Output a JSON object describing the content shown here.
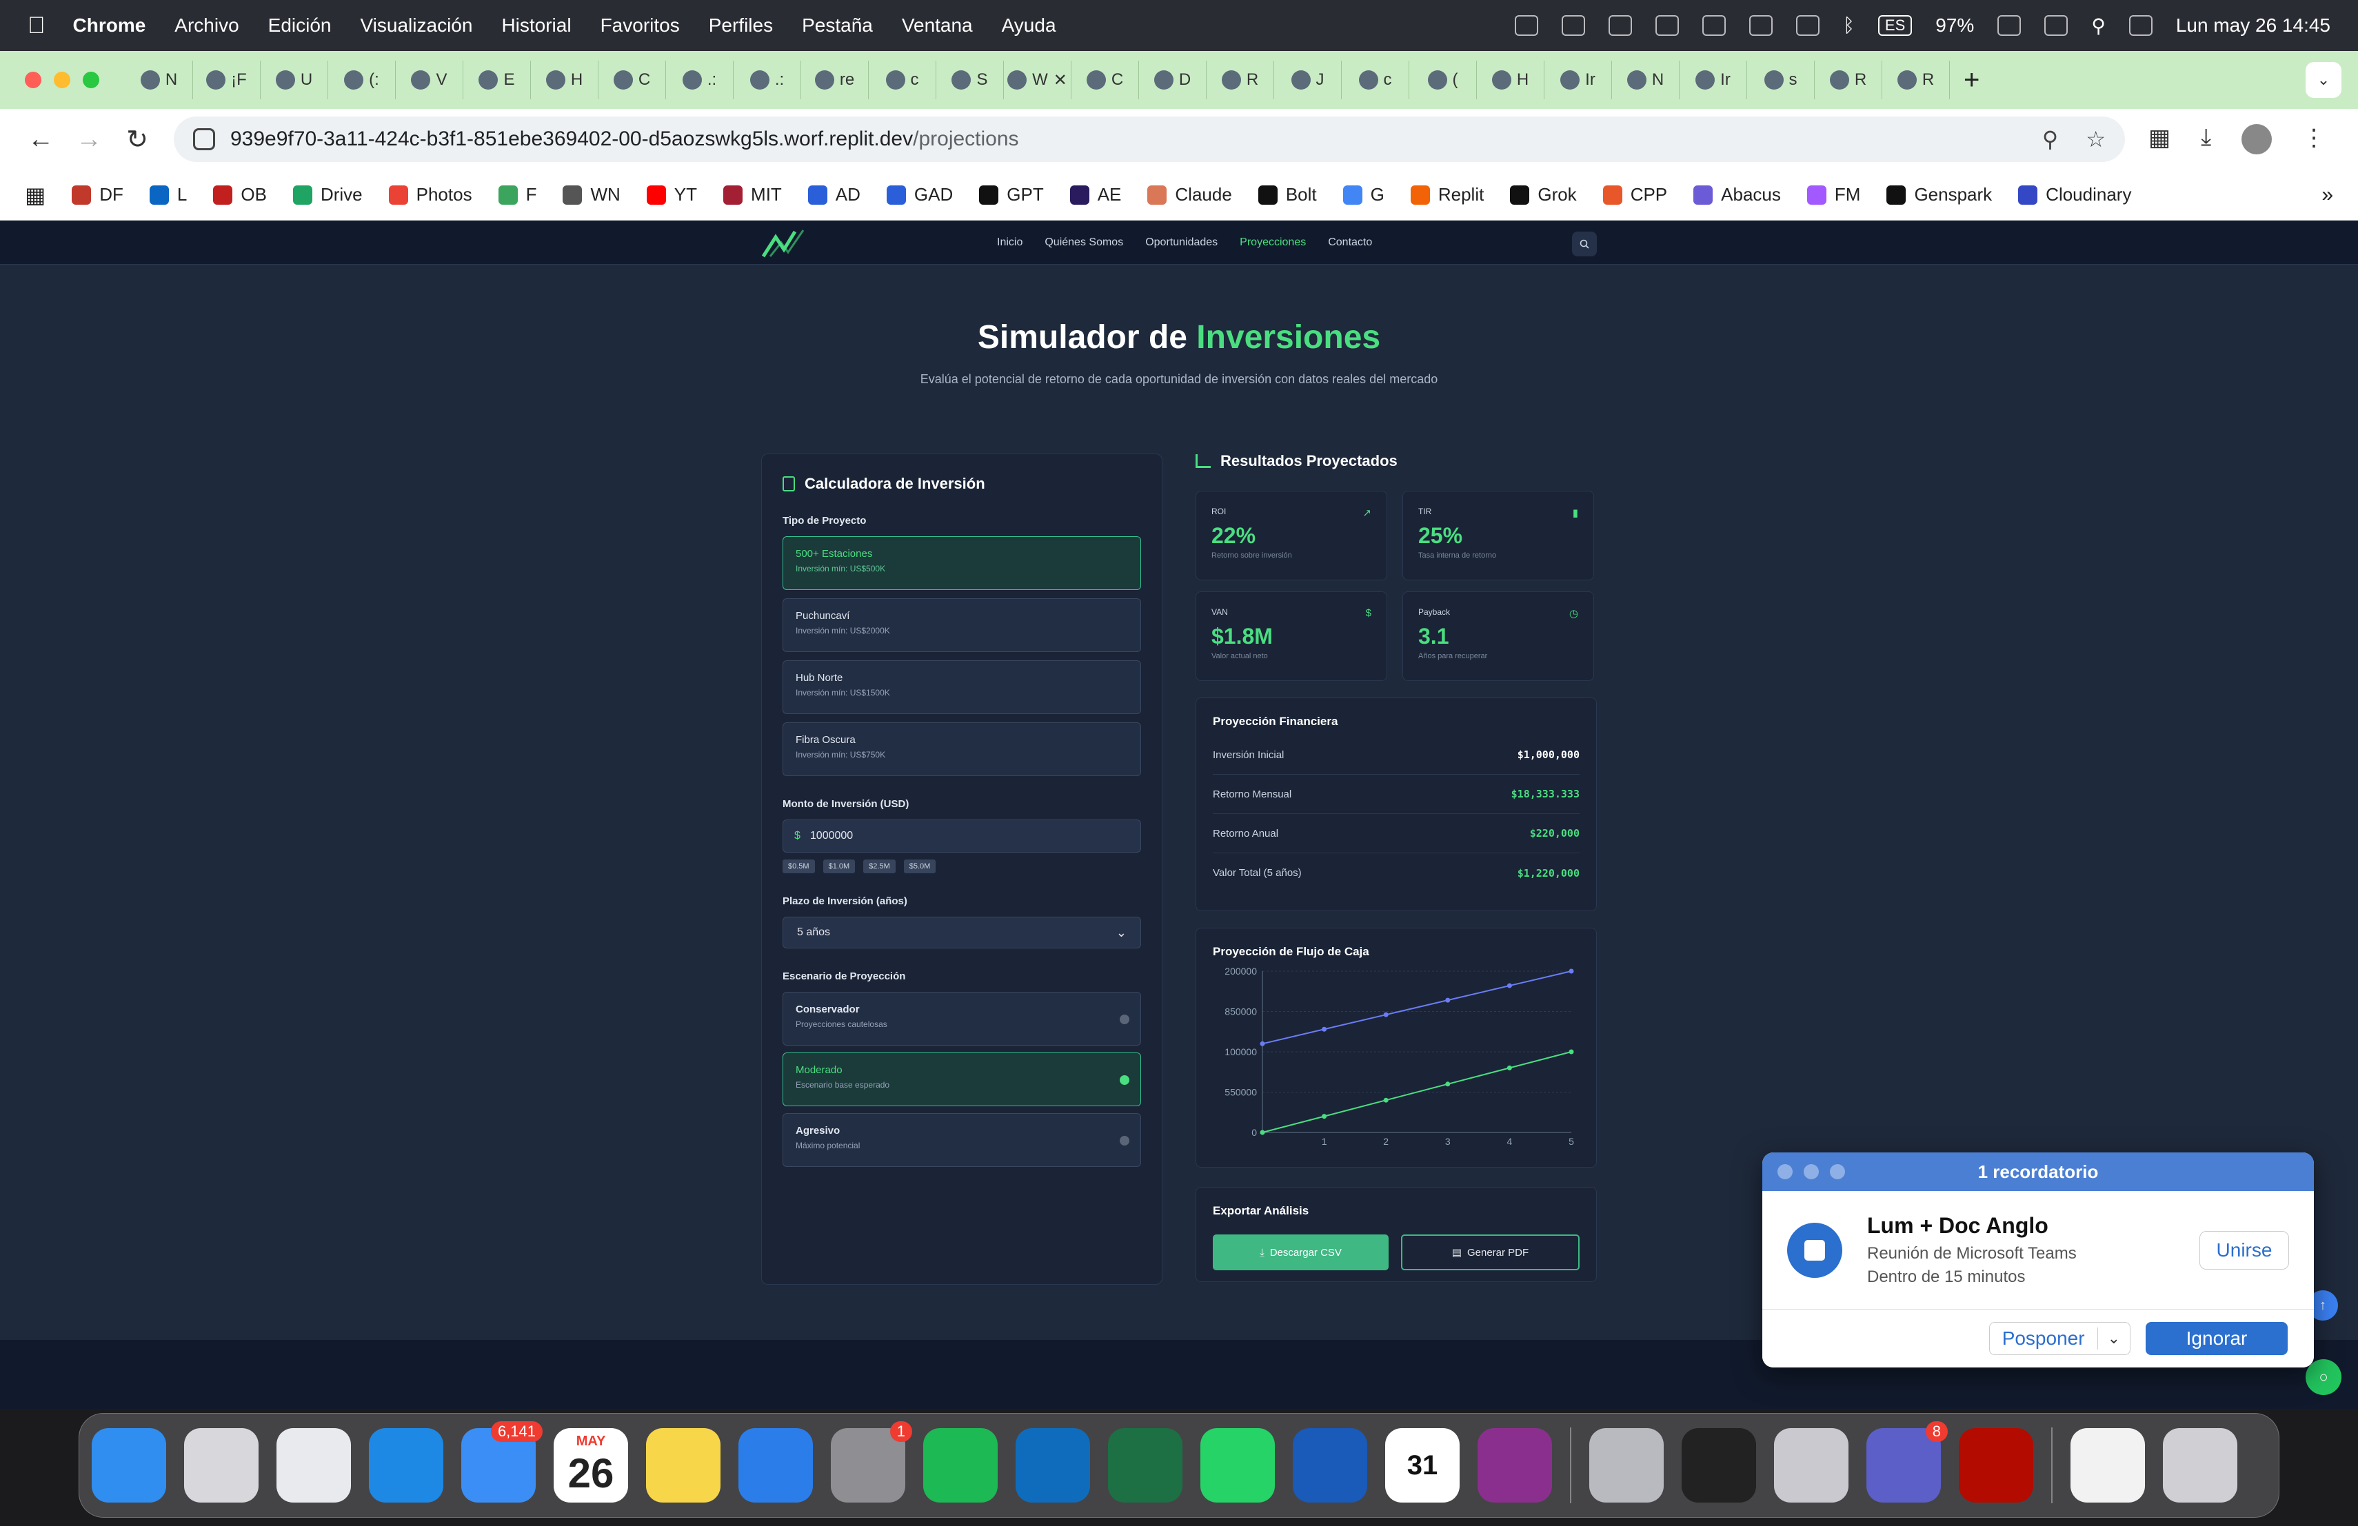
{
  "menubar": {
    "app": "Chrome",
    "items": [
      "Archivo",
      "Edición",
      "Visualización",
      "Historial",
      "Favoritos",
      "Perfiles",
      "Pestaña",
      "Ventana",
      "Ayuda"
    ],
    "lang": "ES",
    "battery": "97%",
    "clock": "Lun may 26  14:45"
  },
  "tabs": {
    "items": [
      "N",
      "¡F",
      "U",
      "(:",
      "V",
      "E",
      "H",
      "C",
      ".:",
      ".:",
      "re",
      "c",
      "S",
      "W",
      "C",
      "D",
      "R",
      "J",
      "c",
      "(",
      "H",
      "Ir",
      "N",
      "Ir",
      "s",
      "R",
      "R"
    ],
    "active": "Ir"
  },
  "address": {
    "host": "939e9f70-3a11-424c-b3f1-851ebe369402-00-d5aozswkg5ls.worf.replit.dev",
    "path": "/projections"
  },
  "bookmarks": [
    {
      "label": "DF",
      "color": "#c0392b"
    },
    {
      "label": "L",
      "color": "#0a66c2"
    },
    {
      "label": "OB",
      "color": "#c21f1f"
    },
    {
      "label": "Drive",
      "color": "#1fa463"
    },
    {
      "label": "Photos",
      "color": "#ea4335"
    },
    {
      "label": "F",
      "color": "#3ba55d"
    },
    {
      "label": "WN",
      "color": "#555555"
    },
    {
      "label": "YT",
      "color": "#ff0000"
    },
    {
      "label": "MIT",
      "color": "#a31f34"
    },
    {
      "label": "AD",
      "color": "#2b5fd9"
    },
    {
      "label": "GAD",
      "color": "#2b5fd9"
    },
    {
      "label": "GPT",
      "color": "#111111"
    },
    {
      "label": "AE",
      "color": "#2a1b5e"
    },
    {
      "label": "Claude",
      "color": "#d97757"
    },
    {
      "label": "Bolt",
      "color": "#111111"
    },
    {
      "label": "G",
      "color": "#4285f4"
    },
    {
      "label": "Replit",
      "color": "#f26207"
    },
    {
      "label": "Grok",
      "color": "#111111"
    },
    {
      "label": "CPP",
      "color": "#e8572a"
    },
    {
      "label": "Abacus",
      "color": "#6b5bd6"
    },
    {
      "label": "FM",
      "color": "#a259ff"
    },
    {
      "label": "Genspark",
      "color": "#111111"
    },
    {
      "label": "Cloudinary",
      "color": "#3448c5"
    }
  ],
  "site": {
    "nav": [
      "Inicio",
      "Quiénes Somos",
      "Oportunidades",
      "Proyecciones",
      "Contacto"
    ],
    "active_nav": "Proyecciones",
    "title_a": "Simulador de ",
    "title_b": "Inversiones",
    "subtitle": "Evalúa el potencial de retorno de cada oportunidad de inversión con datos reales del mercado"
  },
  "calculator": {
    "title": "Calculadora de Inversión",
    "project_label": "Tipo de Proyecto",
    "projects": [
      {
        "name": "500+ Estaciones",
        "min": "Inversión mín: US$500K"
      },
      {
        "name": "Puchuncaví",
        "min": "Inversión mín: US$2000K"
      },
      {
        "name": "Hub Norte",
        "min": "Inversión mín: US$1500K"
      },
      {
        "name": "Fibra Oscura",
        "min": "Inversión mín: US$750K"
      }
    ],
    "amount_label": "Monto de Inversión (USD)",
    "currency": "$",
    "amount": "1000000",
    "chips": [
      "$0.5M",
      "$1.0M",
      "$2.5M",
      "$5.0M"
    ],
    "term_label": "Plazo de Inversión (años)",
    "term": "5 años",
    "scenario_label": "Escenario de Proyección",
    "scenarios": [
      {
        "name": "Conservador",
        "desc": "Proyecciones cautelosas"
      },
      {
        "name": "Moderado",
        "desc": "Escenario base esperado"
      },
      {
        "name": "Agresivo",
        "desc": "Máximo potencial"
      }
    ]
  },
  "results": {
    "title": "Resultados Proyectados",
    "metrics": [
      {
        "label": "ROI",
        "value": "22%",
        "sub": "Retorno sobre inversión"
      },
      {
        "label": "TIR",
        "value": "25%",
        "sub": "Tasa interna de retorno"
      },
      {
        "label": "VAN",
        "value": "$1.8M",
        "sub": "Valor actual neto",
        "icon": "$"
      },
      {
        "label": "Payback",
        "value": "3.1",
        "sub": "Años para recuperar"
      }
    ],
    "financial": {
      "title": "Proyección Financiera",
      "rows": [
        {
          "label": "Inversión Inicial",
          "value": "$1,000,000"
        },
        {
          "label": "Retorno Mensual",
          "value": "$18,333.333"
        },
        {
          "label": "Retorno Anual",
          "value": "$220,000"
        },
        {
          "label": "Valor Total (5 años)",
          "value": "$1,220,000"
        }
      ]
    },
    "cashflow_title": "Proyección de Flujo de Caja",
    "export": {
      "title": "Exportar Análisis",
      "csv": "Descargar CSV",
      "pdf": "Generar PDF"
    }
  },
  "chart_data": {
    "type": "line",
    "x": [
      0,
      1,
      2,
      3,
      4,
      5
    ],
    "xticks": [
      "1",
      "2",
      "3",
      "4",
      "5"
    ],
    "yticks": [
      "200000",
      "850000",
      "100000",
      "550000",
      "0"
    ],
    "series": [
      {
        "color": "#6b7cf6",
        "values": [
          0.55,
          0.64,
          0.73,
          0.82,
          0.91,
          1.0
        ]
      },
      {
        "color": "#4ade80",
        "values": [
          0.0,
          0.1,
          0.2,
          0.3,
          0.4,
          0.5
        ]
      }
    ]
  },
  "notification": {
    "header": "1 recordatorio",
    "title": "Lum + Doc Anglo",
    "subtitle": "Reunión de Microsoft Teams",
    "time": "Dentro de 15 minutos",
    "join": "Unirse",
    "snooze": "Posponer",
    "dismiss": "Ignorar"
  },
  "dock": {
    "apps": [
      {
        "name": "finder",
        "color": "#2f8ef0"
      },
      {
        "name": "launchpad",
        "color": "#d8d8dc"
      },
      {
        "name": "chrome",
        "color": "#e8eaed"
      },
      {
        "name": "safari",
        "color": "#1e88e5"
      },
      {
        "name": "mail",
        "color": "#3a8ef6",
        "badge": "6,141"
      },
      {
        "name": "calendar",
        "color": "#ffffff",
        "month": "MAY",
        "day": "26"
      },
      {
        "name": "notes",
        "color": "#f7d64a"
      },
      {
        "name": "keynote",
        "color": "#2b7de9"
      },
      {
        "name": "system-settings",
        "color": "#8e8e93",
        "badge": "1"
      },
      {
        "name": "spotify",
        "color": "#1db954"
      },
      {
        "name": "outlook",
        "color": "#0f6cbd"
      },
      {
        "name": "excel",
        "color": "#1d7044"
      },
      {
        "name": "whatsapp",
        "color": "#25d366"
      },
      {
        "name": "word",
        "color": "#1a5ab8"
      },
      {
        "name": "fantastical",
        "color": "#ffffff",
        "day": "31"
      },
      {
        "name": "loom",
        "color": "#8b2f8e"
      },
      {
        "name": "iphone-mirroring",
        "color": "#b9b9c0"
      },
      {
        "name": "replit",
        "color": "#222222"
      },
      {
        "name": "preview",
        "color": "#c9c9cf"
      },
      {
        "name": "teams",
        "color": "#5b5fc7",
        "badge": "8"
      },
      {
        "name": "acrobat",
        "color": "#b30b00"
      },
      {
        "name": "site-shortcut",
        "color": "#f2f2f2"
      },
      {
        "name": "trash",
        "color": "#d0d0d4"
      }
    ]
  }
}
